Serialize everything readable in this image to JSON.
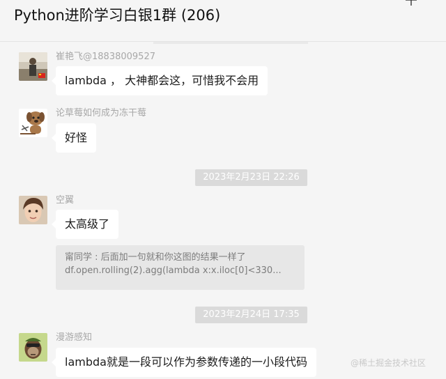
{
  "chat": {
    "title": "Python进阶学习白银1群 (206)"
  },
  "messages": [
    {
      "sender": "崔艳飞@18838009527",
      "text": "lambda ， 大神都会这，可惜我不会用",
      "avatar_icon": "photo-avatar"
    },
    {
      "sender": "论草莓如何成为冻干莓",
      "text": "好怪",
      "avatar_icon": "cartoon-dog-avatar"
    },
    {
      "sender": "空翼",
      "text": "太高级了",
      "avatar_icon": "portrait-avatar"
    },
    {
      "sender": "漫游感知",
      "text": "lambda就是一段可以作为参数传递的一小段代码",
      "avatar_icon": "ape-avatar"
    }
  ],
  "quote": {
    "line1": "甯同学 : 后面加一句就和你这图的结果一样了",
    "line2": "df.open.rolling(2).agg(lambda x:x.iloc[0]<330..."
  },
  "timestamps": [
    "2023年2月23日 22:26",
    "2023年2月24日 17:35"
  ],
  "watermark": "@稀土掘金技术社区",
  "colors": {
    "background": "#f5f5f5",
    "bubble": "#ffffff",
    "quote_background": "#e7e7e7",
    "timestamp_background": "#dadada"
  }
}
